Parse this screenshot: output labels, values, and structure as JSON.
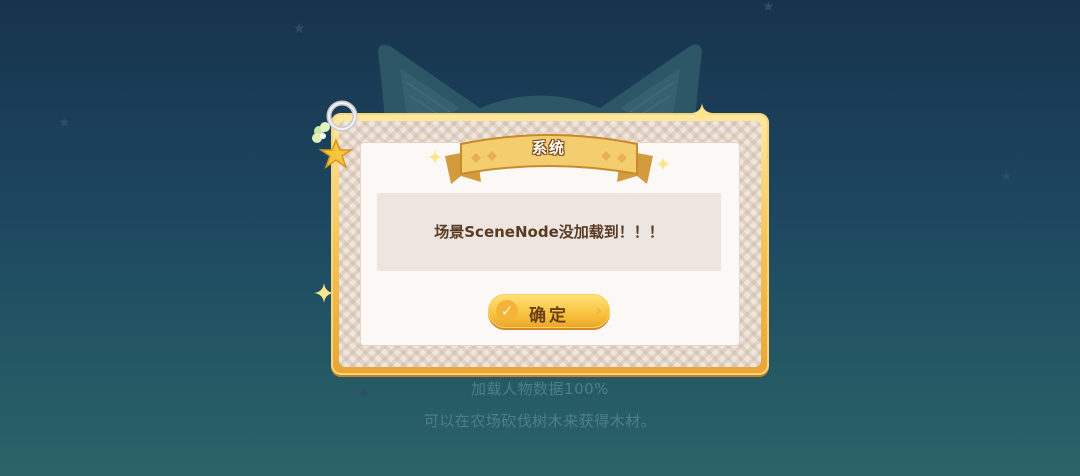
{
  "dialog": {
    "title": "系统",
    "message": "场景SceneNode没加载到！！！",
    "confirm_label": "确定"
  },
  "loading": {
    "progress_text": "加载人物数据100%",
    "tip_text": "可以在农场砍伐树木来获得木材。"
  },
  "colors": {
    "background_top": "#17334d",
    "background_bottom": "#2a6468",
    "frame_gold": "#f6c455",
    "paper": "#fbf8f5",
    "message_text": "#5a3b22",
    "button_gold": "#f8c33f"
  },
  "icons": [
    "star-icon",
    "sparkle-icon",
    "check-icon",
    "arrow-right-icon",
    "clover-icon",
    "ring-icon"
  ]
}
